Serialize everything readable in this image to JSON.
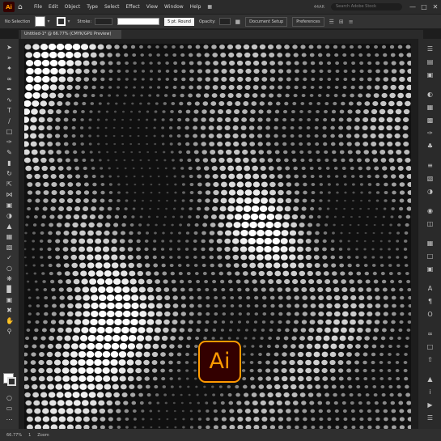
{
  "app": {
    "logo_text": "Ai"
  },
  "menu": [
    "File",
    "Edit",
    "Object",
    "Type",
    "Select",
    "Effect",
    "View",
    "Window",
    "Help"
  ],
  "workspace_label": "44AR",
  "search": {
    "placeholder": "Search Adobe Stock"
  },
  "window_controls": [
    "—",
    "□",
    "✕"
  ],
  "control_bar": {
    "selection_label": "No Selection",
    "stroke_label": "Stroke:",
    "brush_label": "5 pt. Round",
    "opacity_label": "Opacity:",
    "doc_setup": "Document Setup",
    "preferences": "Preferences"
  },
  "document_tab": {
    "title": "Untitled-1* @ 66.77% (CMYK/GPU Preview)"
  },
  "status": {
    "zoom": "66.77%",
    "page": "1",
    "tool": "Zoom"
  },
  "badge": {
    "text": "Ai"
  },
  "colors": {
    "accent": "#ff9a00",
    "badge_bg": "#330000",
    "ui_bg": "#323232"
  },
  "icons": {
    "tools": [
      "selection-arrow-icon",
      "direct-selection-icon",
      "magic-wand-icon",
      "lasso-icon",
      "pen-icon",
      "curvature-icon",
      "type-icon",
      "line-icon",
      "rectangle-icon",
      "paintbrush-icon",
      "pencil-icon",
      "eraser-icon",
      "rotate-icon",
      "scale-icon",
      "width-icon",
      "free-transform-icon",
      "shape-builder-icon",
      "perspective-icon",
      "mesh-icon",
      "gradient-icon",
      "eyedropper-icon",
      "blend-icon",
      "symbol-sprayer-icon",
      "graph-icon",
      "artboard-icon",
      "slice-icon",
      "hand-icon",
      "zoom-icon"
    ],
    "panels": [
      "properties-icon",
      "layers-icon",
      "libraries-icon",
      "color-icon",
      "color-guide-icon",
      "swatches-icon",
      "brushes-icon",
      "symbols-icon",
      "stroke-icon",
      "gradient-panel-icon",
      "transparency-icon",
      "appearance-icon",
      "graphic-styles-icon",
      "align-icon",
      "pathfinder-icon",
      "transform-icon",
      "character-icon",
      "paragraph-icon",
      "opentype-icon",
      "links-icon",
      "artboards-icon",
      "asset-export-icon",
      "navigator-icon",
      "info-icon",
      "actions-icon",
      "document-info-icon"
    ]
  }
}
